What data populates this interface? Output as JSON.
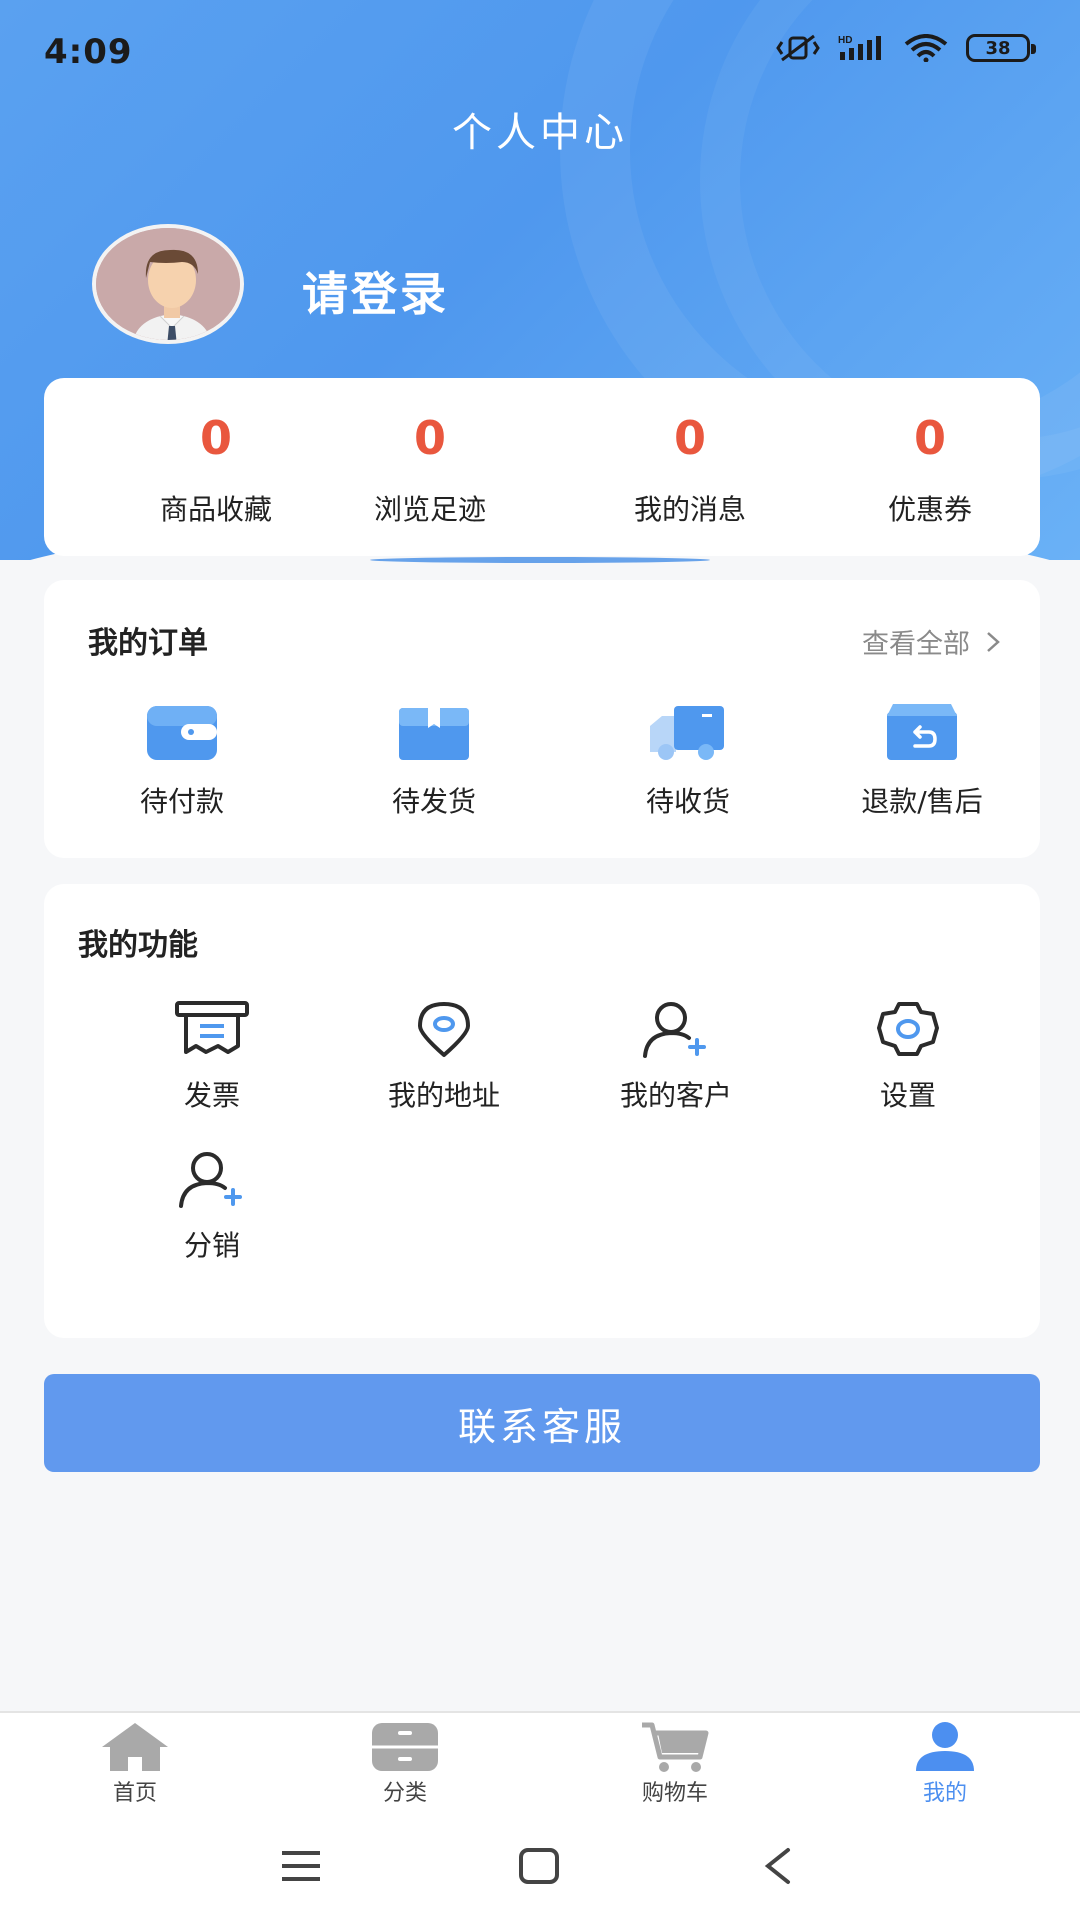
{
  "status": {
    "time": "4:09",
    "battery": "38"
  },
  "header": {
    "title": "个人中心"
  },
  "profile": {
    "login_text": "请登录"
  },
  "stats": [
    {
      "value": "0",
      "label": "商品收藏"
    },
    {
      "value": "0",
      "label": "浏览足迹"
    },
    {
      "value": "0",
      "label": "我的消息"
    },
    {
      "value": "0",
      "label": "优惠券"
    }
  ],
  "orders": {
    "title": "我的订单",
    "view_all": "查看全部",
    "items": [
      {
        "label": "待付款",
        "icon": "wallet-icon"
      },
      {
        "label": "待发货",
        "icon": "box-icon"
      },
      {
        "label": "待收货",
        "icon": "truck-icon"
      },
      {
        "label": "退款/售后",
        "icon": "refund-box-icon"
      }
    ]
  },
  "functions": {
    "title": "我的功能",
    "items": [
      {
        "label": "发票",
        "icon": "invoice-icon"
      },
      {
        "label": "我的地址",
        "icon": "location-icon"
      },
      {
        "label": "我的客户",
        "icon": "add-user-icon"
      },
      {
        "label": "设置",
        "icon": "gear-icon"
      },
      {
        "label": "分销",
        "icon": "add-user-icon"
      }
    ]
  },
  "contact_button": "联系客服",
  "tabbar": [
    {
      "label": "首页",
      "icon": "home-icon"
    },
    {
      "label": "分类",
      "icon": "category-icon"
    },
    {
      "label": "购物车",
      "icon": "cart-icon"
    },
    {
      "label": "我的",
      "icon": "user-icon",
      "active": true
    }
  ],
  "colors": {
    "primary": "#4f98ee",
    "accent_red": "#e9573e",
    "button": "#6199ee",
    "active_tab": "#4c8ff0"
  }
}
